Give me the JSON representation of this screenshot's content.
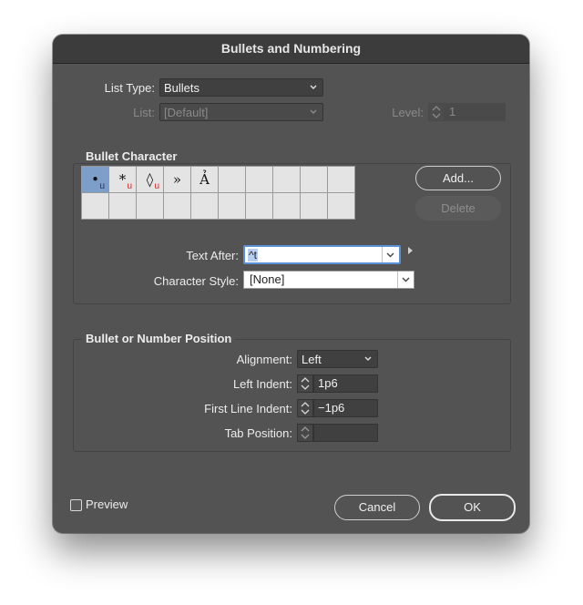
{
  "dialog": {
    "title": "Bullets and Numbering"
  },
  "list_type": {
    "label": "List Type:",
    "value": "Bullets"
  },
  "list": {
    "label": "List:",
    "value": "[Default]"
  },
  "level": {
    "label": "Level:",
    "value": "1"
  },
  "bullet_character": {
    "title": "Bullet Character",
    "cells": [
      {
        "glyph": "•",
        "sub": "u",
        "selected": true
      },
      {
        "glyph": "*",
        "sub": "u",
        "selected": false
      },
      {
        "glyph": "◊",
        "sub": "u",
        "selected": false
      },
      {
        "glyph": "»",
        "sub": "",
        "selected": false
      },
      {
        "glyph": "Ả",
        "sub": "",
        "selected": false
      }
    ],
    "add_label": "Add...",
    "delete_label": "Delete"
  },
  "text_after": {
    "label": "Text After:",
    "value": "^t"
  },
  "character_style": {
    "label": "Character Style:",
    "value": "[None]"
  },
  "position": {
    "title": "Bullet or Number Position",
    "alignment_label": "Alignment:",
    "alignment_value": "Left",
    "left_indent_label": "Left Indent:",
    "left_indent_value": "1p6",
    "first_line_indent_label": "First Line Indent:",
    "first_line_indent_value": "−1p6",
    "tab_position_label": "Tab Position:",
    "tab_position_value": ""
  },
  "footer": {
    "preview_label": "Preview",
    "cancel_label": "Cancel",
    "ok_label": "OK"
  },
  "icons": [
    "chevron-down-icon",
    "stepper-icon",
    "flyout-triangle-icon",
    "checkbox-icon"
  ],
  "colors": {
    "dialog_bg": "#535353",
    "titlebar_bg": "#3c3c3c",
    "selection": "#7d9ec9",
    "focus": "#5b8fd6",
    "marker_red": "#e0211c"
  }
}
